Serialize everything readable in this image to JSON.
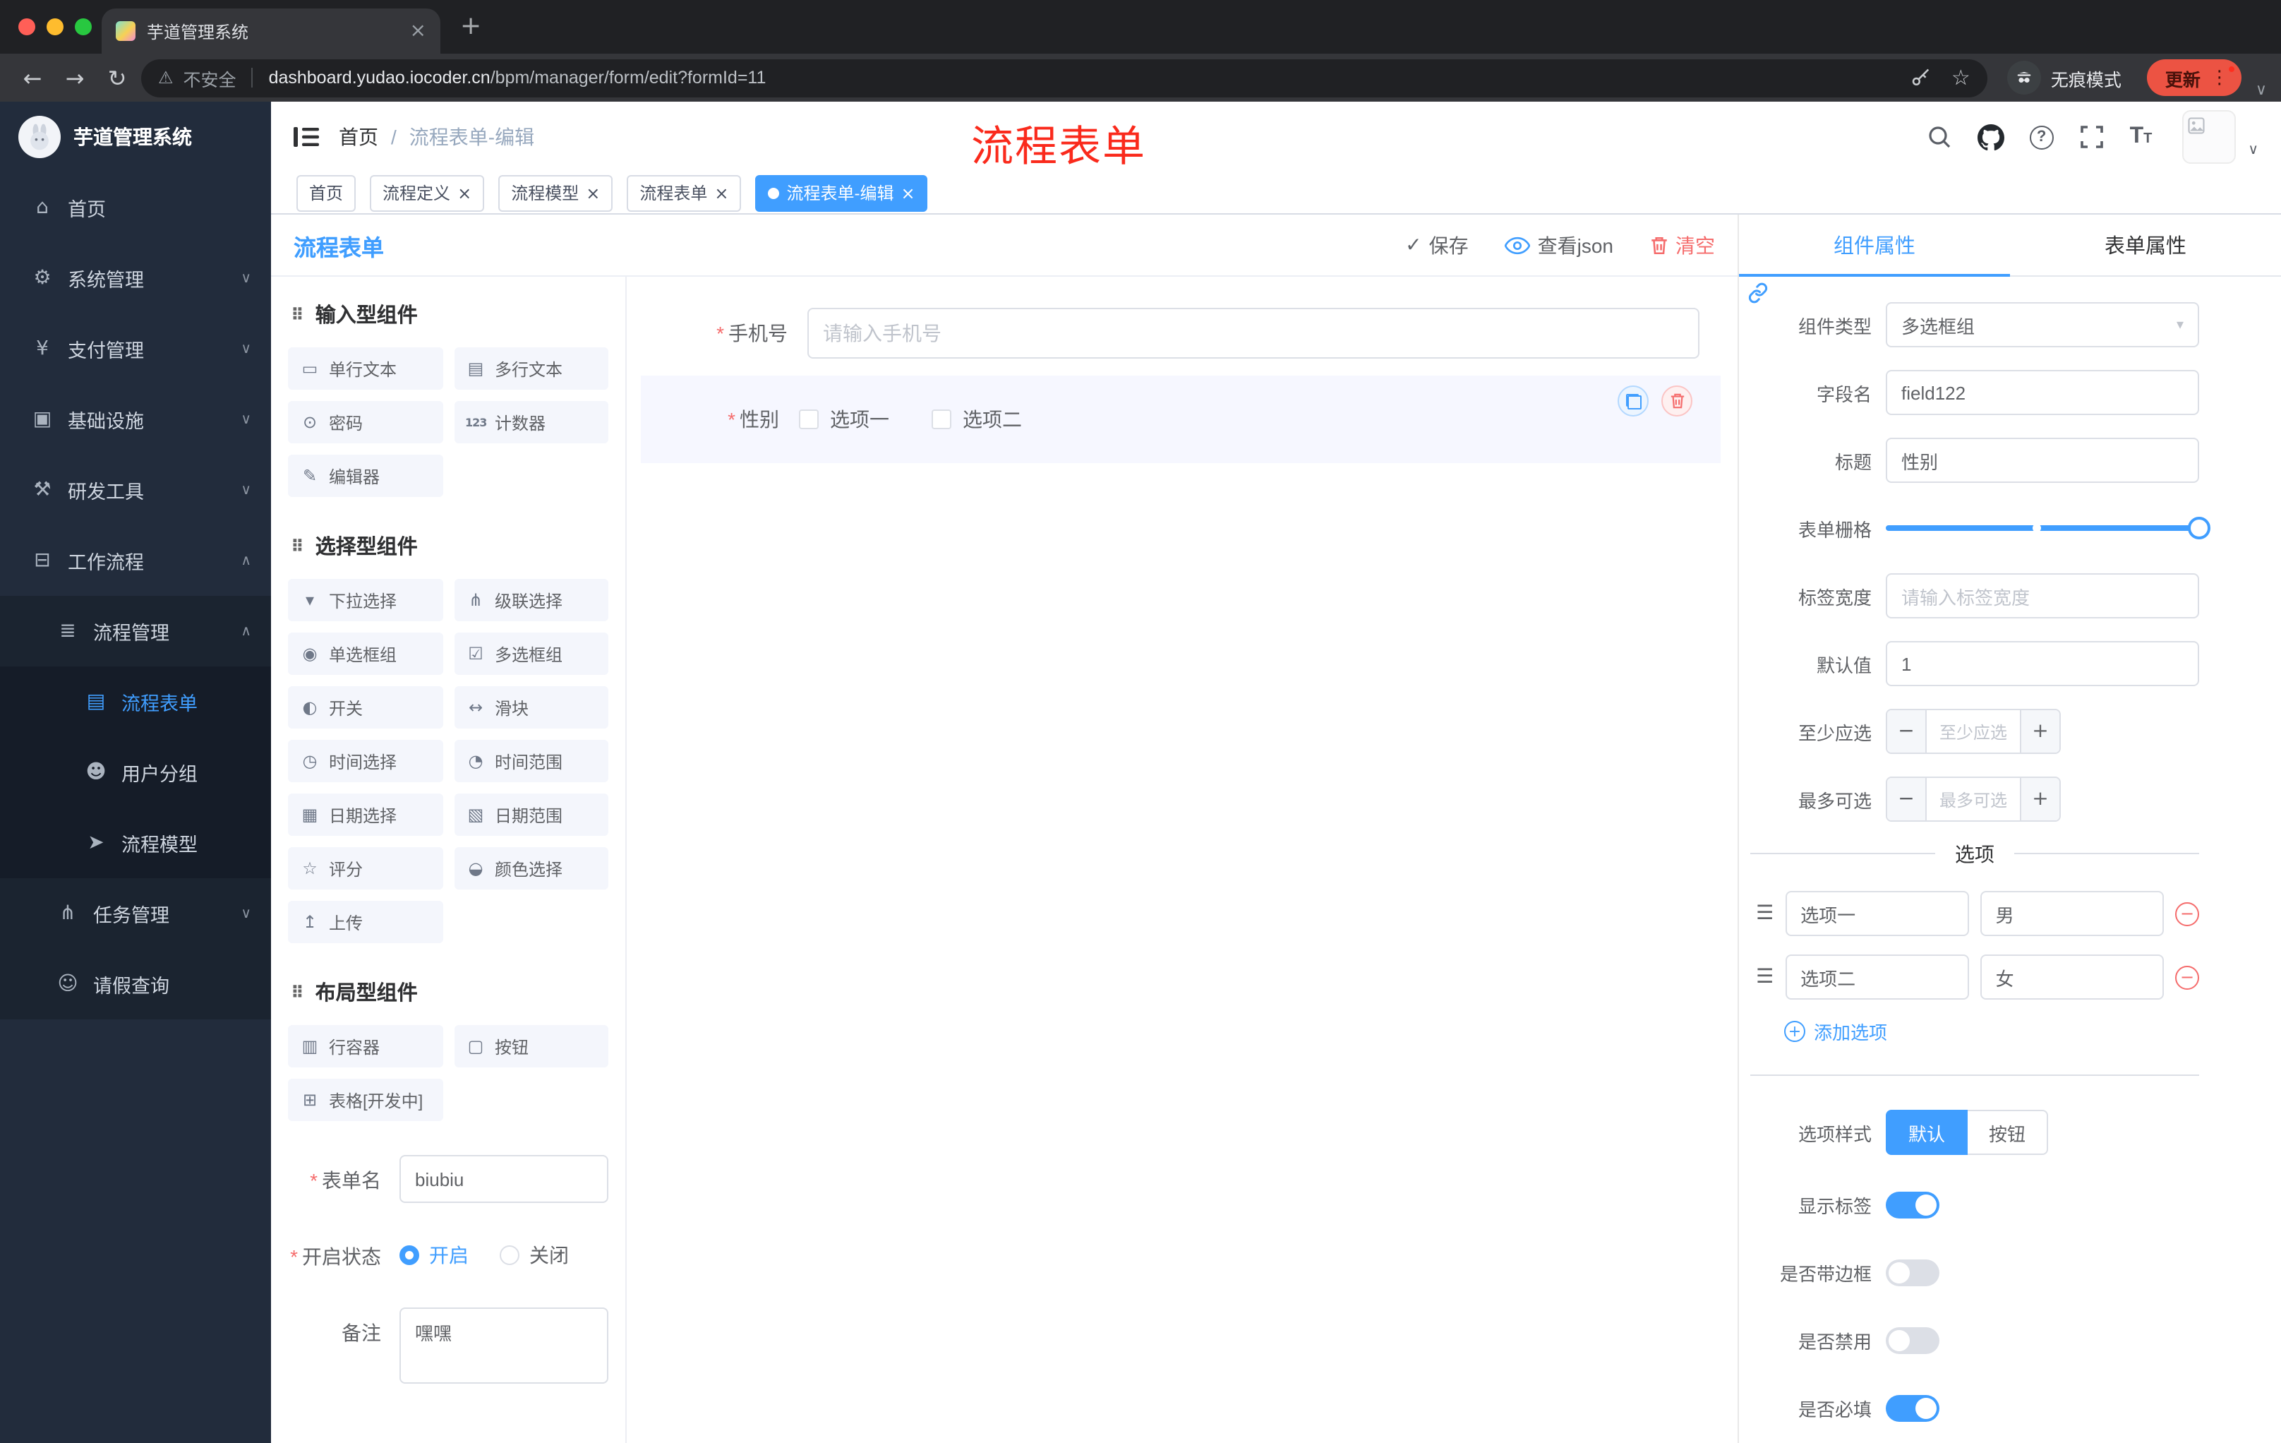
{
  "colors": {
    "accent": "#409eff",
    "danger": "#f56c6c",
    "annotation_red": "#fa2a1c",
    "sidebar_bg": "#222c3c",
    "active_tag_bg": "#409eff"
  },
  "browser": {
    "tab": {
      "title": "芋道管理系统"
    },
    "address": {
      "security": "不安全",
      "domain": "dashboard.yudao.iocoder.cn",
      "path": "/bpm/manager/form/edit?formId=11"
    },
    "incognito_label": "无痕模式",
    "update_label": "更新"
  },
  "sidebar": {
    "logo_title": "芋道管理系统",
    "items": [
      {
        "label": "首页",
        "icon": "⌂"
      },
      {
        "label": "系统管理",
        "icon": "⚙"
      },
      {
        "label": "支付管理",
        "icon": "¥"
      },
      {
        "label": "基础设施",
        "icon": "▣"
      },
      {
        "label": "研发工具",
        "icon": "⚒"
      },
      {
        "label": "工作流程",
        "icon": "⊟"
      },
      {
        "label": "流程管理",
        "icon": "≣"
      },
      {
        "label": "流程表单",
        "icon": "▤"
      },
      {
        "label": "用户分组",
        "icon": "☻"
      },
      {
        "label": "流程模型",
        "icon": "➤"
      },
      {
        "label": "任务管理",
        "icon": "⋔"
      },
      {
        "label": "请假查询",
        "icon": "☺"
      }
    ]
  },
  "header": {
    "breadcrumb": {
      "root": "首页",
      "sep": "/",
      "current": "流程表单-编辑"
    },
    "annotation": "流程表单"
  },
  "tags": [
    {
      "label": "首页",
      "closable": false,
      "active": false
    },
    {
      "label": "流程定义",
      "closable": true,
      "active": false
    },
    {
      "label": "流程模型",
      "closable": true,
      "active": false
    },
    {
      "label": "流程表单",
      "closable": true,
      "active": false
    },
    {
      "label": "流程表单-编辑",
      "closable": true,
      "active": true
    }
  ],
  "designer": {
    "title": "流程表单",
    "actions": {
      "save": "保存",
      "view_json": "查看json",
      "clear": "清空"
    },
    "palette": {
      "sections": [
        {
          "title": "输入型组件",
          "items": [
            {
              "label": "单行文本",
              "glyph": "▭",
              "icon_name": "single-line-text-icon"
            },
            {
              "label": "多行文本",
              "glyph": "▤",
              "icon_name": "textarea-icon"
            },
            {
              "label": "密码",
              "glyph": "⊙",
              "icon_name": "password-icon"
            },
            {
              "label": "计数器",
              "glyph": "123",
              "wide": true,
              "icon_name": "counter-icon"
            },
            {
              "label": "编辑器",
              "glyph": "✎",
              "icon_name": "editor-icon"
            }
          ]
        },
        {
          "title": "选择型组件",
          "items": [
            {
              "label": "下拉选择",
              "glyph": "▾",
              "icon_name": "select-icon"
            },
            {
              "label": "级联选择",
              "glyph": "⋔",
              "icon_name": "cascader-icon"
            },
            {
              "label": "单选框组",
              "glyph": "◉",
              "icon_name": "radio-group-icon"
            },
            {
              "label": "多选框组",
              "glyph": "☑",
              "icon_name": "checkbox-group-icon"
            },
            {
              "label": "开关",
              "glyph": "◐",
              "icon_name": "switch-icon"
            },
            {
              "label": "滑块",
              "glyph": "↔",
              "icon_name": "slider-icon"
            },
            {
              "label": "时间选择",
              "glyph": "◷",
              "icon_name": "time-picker-icon"
            },
            {
              "label": "时间范围",
              "glyph": "◔",
              "icon_name": "time-range-icon"
            },
            {
              "label": "日期选择",
              "glyph": "▦",
              "icon_name": "date-picker-icon"
            },
            {
              "label": "日期范围",
              "glyph": "▧",
              "icon_name": "date-range-icon"
            },
            {
              "label": "评分",
              "glyph": "☆",
              "icon_name": "rate-icon"
            },
            {
              "label": "颜色选择",
              "glyph": "◒",
              "icon_name": "color-picker-icon"
            },
            {
              "label": "上传",
              "glyph": "↥",
              "icon_name": "upload-icon"
            }
          ]
        },
        {
          "title": "布局型组件",
          "items": [
            {
              "label": "行容器",
              "glyph": "▥",
              "icon_name": "row-container-icon"
            },
            {
              "label": "按钮",
              "glyph": "▢",
              "icon_name": "button-icon"
            },
            {
              "label": "表格[开发中]",
              "glyph": "⊞",
              "icon_name": "table-icon"
            }
          ]
        }
      ]
    },
    "settings_form": {
      "name_label": "表单名",
      "name_value": "biubiu",
      "status_label": "开启状态",
      "status_on": "开启",
      "status_off": "关闭",
      "remark_label": "备注",
      "remark_value": "嘿嘿"
    },
    "canvas": {
      "phone_label": "手机号",
      "phone_placeholder": "请输入手机号",
      "gender_label": "性别",
      "gender_options": [
        "选项一",
        "选项二"
      ]
    },
    "props": {
      "tab_component": "组件属性",
      "tab_form": "表单属性",
      "rows": {
        "component_type": {
          "label": "组件类型",
          "value": "多选框组"
        },
        "field_name": {
          "label": "字段名",
          "value": "field122"
        },
        "title": {
          "label": "标题",
          "value": "性别"
        },
        "grid": {
          "label": "表单栅格"
        },
        "label_width": {
          "label": "标签宽度",
          "placeholder": "请输入标签宽度"
        },
        "default": {
          "label": "默认值",
          "value": "1"
        },
        "min": {
          "label": "至少应选",
          "placeholder": "至少应选"
        },
        "max": {
          "label": "最多可选",
          "placeholder": "最多可选"
        }
      },
      "options_title": "选项",
      "options": [
        {
          "label": "选项一",
          "value": "男"
        },
        {
          "label": "选项二",
          "value": "女"
        }
      ],
      "add_option": "添加选项",
      "option_style": {
        "label": "选项样式",
        "choices": [
          {
            "label": "默认",
            "active": true
          },
          {
            "label": "按钮",
            "active": false
          }
        ]
      },
      "switches": [
        {
          "label": "显示标签",
          "on": true
        },
        {
          "label": "是否带边框",
          "on": false
        },
        {
          "label": "是否禁用",
          "on": false
        },
        {
          "label": "是否必填",
          "on": true
        }
      ]
    }
  }
}
